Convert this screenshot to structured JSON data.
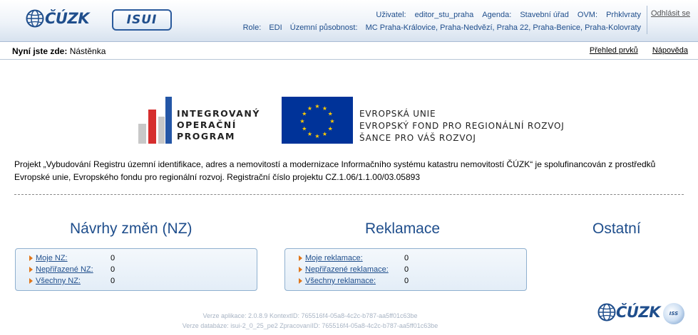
{
  "header": {
    "logo_text": "ČÚZK",
    "isui_logo_text": "ISUI",
    "user_label": "Uživatel:",
    "user_value": "editor_stu_praha",
    "agenda_label": "Agenda:",
    "agenda_value": "Stavební úřad",
    "ovm_label": "OVM:",
    "ovm_value": "Prhklvraty",
    "role_label": "Role:",
    "role_value": "EDI",
    "uzemni_label": "Územní působnost:",
    "uzemni_value": "MC Praha-Královice, Praha-Nedvězí, Praha 22, Praha-Benice, Praha-Kolovraty",
    "logout": "Odhlásit se"
  },
  "breadcrumb": {
    "label": "Nyní jste zde:",
    "current": "Nástěnka",
    "links": [
      "Přehled prvků",
      "Nápověda"
    ]
  },
  "logos": {
    "iop_lines": [
      "INTEGROVANÝ",
      "OPERAČNÍ",
      "PROGRAM"
    ],
    "eu_lines": [
      "EVROPSKÁ UNIE",
      "EVROPSKÝ FOND PRO REGIONÁLNÍ ROZVOJ",
      "ŠANCE PRO VÁŠ ROZVOJ"
    ]
  },
  "project_text": "Projekt „Vybudování Registru územní identifikace, adres a nemovitostí a modernizace Informačního systému katastru nemovitostí ČÚZK“ je spolufinancován z prostředků Evropské unie, Evropského fondu pro regionální rozvoj. Registrační číslo projektu CZ.1.06/1.1.00/03.05893",
  "sections": {
    "nz": {
      "title": "Návrhy změn (NZ)",
      "rows": [
        {
          "label": "Moje NZ:",
          "count": "0"
        },
        {
          "label": "Nepřiřazené NZ:",
          "count": "0"
        },
        {
          "label": "Všechny NZ:",
          "count": "0"
        }
      ]
    },
    "reklamace": {
      "title": "Reklamace",
      "rows": [
        {
          "label": "Moje reklamace:",
          "count": "0"
        },
        {
          "label": "Nepřiřazené reklamace:",
          "count": "0"
        },
        {
          "label": "Všechny reklamace:",
          "count": "0"
        }
      ]
    },
    "ostatni": {
      "title": "Ostatní"
    }
  },
  "footer": {
    "line1": "Verze aplikace: 2.0.8.9 KontextID: 765516f4-05a8-4c2c-b787-aa5ff01c63be",
    "line2": "Verze databáze: isui-2_0_25_pe2 ZpracovaníID: 765516f4-05a8-4c2c-b787-aa5ff01c63be",
    "logo_text": "ČÚZK",
    "iss_logo_text": "ISS"
  },
  "colors": {
    "brand_blue": "#1f4e8c",
    "eu_blue": "#003399",
    "eu_star": "#ffcc00",
    "iop_red": "#d62e2e",
    "iop_blue": "#2456a6",
    "iop_gray": "#c8c8c8",
    "arrow_orange": "#e0761a"
  }
}
